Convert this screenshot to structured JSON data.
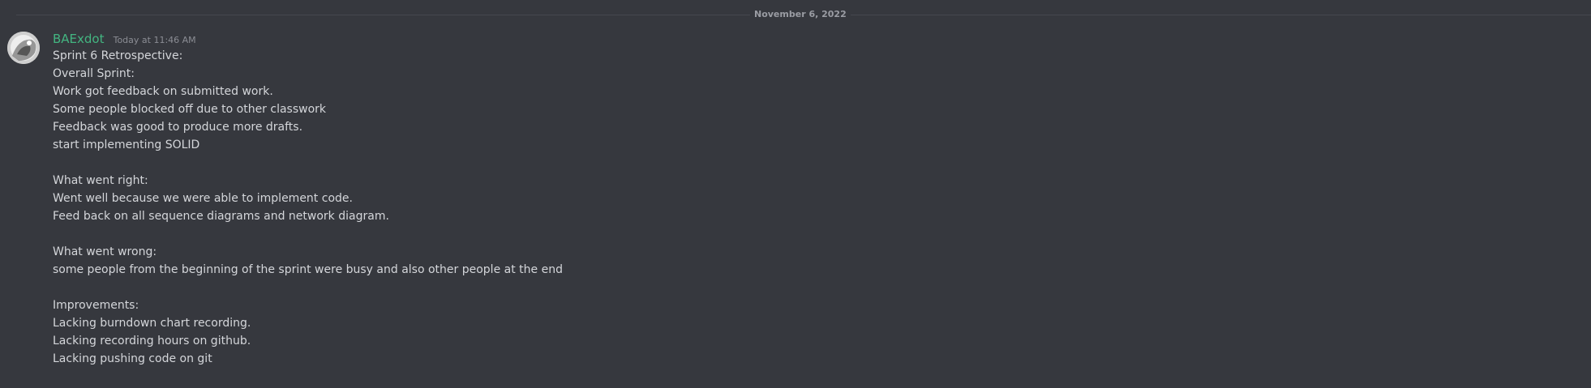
{
  "date_divider": "November 6, 2022",
  "message": {
    "avatar_icon": "user-avatar-icon",
    "username": "BAExdot",
    "timestamp": "Today at 11:46 AM",
    "lines": [
      "Sprint 6 Retrospective:",
      "Overall Sprint:",
      "Work got feedback on submitted work.",
      "Some people blocked off due to other classwork",
      "Feedback was good to produce more drafts.",
      "start implementing SOLID",
      "",
      "What went right:",
      "Went well because we were able to implement code.",
      "Feed back on all sequence diagrams and network diagram.",
      "",
      "What went wrong:",
      "some people from the beginning of the sprint were busy and also other people at the end",
      "",
      "Improvements:",
      "Lacking burndown chart recording.",
      "Lacking recording hours on github.",
      "Lacking pushing code on git"
    ]
  },
  "colors": {
    "background": "#36383e",
    "username": "#43b581",
    "text": "#d4d6da",
    "muted": "#8b8d94"
  }
}
